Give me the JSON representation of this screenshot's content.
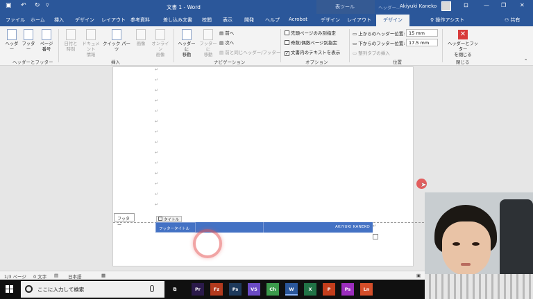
{
  "titlebar": {
    "document_title": "文書 1 - Word",
    "context_group": "表ツール",
    "context_dim": "ヘッダー...",
    "user_name": "Akiyuki Kaneko"
  },
  "tabs": {
    "items": [
      "ファイル",
      "ホーム",
      "挿入",
      "デザイン",
      "レイアウト",
      "参考資料",
      "差し込み文書",
      "校閲",
      "表示",
      "開発",
      "ヘルプ",
      "Acrobat",
      "デザイン",
      "レイアウト"
    ],
    "active": "デザイン",
    "assist": "操作アシスト",
    "share": "共有"
  },
  "ribbon": {
    "hf_group": {
      "label": "ヘッダーとフッター",
      "header": "ヘッダー",
      "footer": "フッター",
      "page_number": "ページ\n番号"
    },
    "insert_group": {
      "label": "挿入",
      "datetime": "日付と\n時刻",
      "docinfo": "ドキュメント\n情報",
      "quickparts": "クイック パーツ",
      "picture": "画像",
      "online_picture": "オンライン\n画像"
    },
    "nav_group": {
      "label": "ナビゲーション",
      "goto_header": "ヘッダーに\n移動",
      "goto_footer": "フッターに\n移動",
      "prev": "前へ",
      "next": "次へ",
      "link_prev": "前と同じヘッダー/フッター"
    },
    "options_group": {
      "label": "オプション",
      "first_page": "先頭ページのみ別指定",
      "odd_even": "奇数/偶数ページ別指定",
      "show_text": "文書内のテキストを表示"
    },
    "position_group": {
      "label": "位置",
      "header_top_label": "上からのヘッダー位置:",
      "header_top_value": "15 mm",
      "footer_bottom_label": "下からのフッター位置:",
      "footer_bottom_value": "17.5 mm",
      "align_tab": "整列タブの挿入"
    },
    "close_group": {
      "label": "閉じる",
      "close": "ヘッダーとフッター\nを閉じる"
    }
  },
  "document": {
    "paragraph_mark": "↵",
    "footer_label": "フッター",
    "title_tag": "タイトル",
    "footer_left": "フッタータイトル",
    "footer_right": "AKIYUKI KANEKO"
  },
  "statusbar": {
    "page": "1/3 ページ",
    "words": "0 文字",
    "language": "日本語"
  },
  "taskbar": {
    "search_placeholder": "ここに入力して検索",
    "apps": [
      "Pr",
      "Fz",
      "Ps",
      "VS",
      "Ch",
      "W",
      "X",
      "P",
      "Ps",
      "Ln"
    ],
    "app_colors": [
      "#2b1a4a",
      "#b23a1e",
      "#1e3a5c",
      "#6b4bc4",
      "#3c9a4c",
      "#2b579a",
      "#217346",
      "#c43e1c",
      "#9b2dbd",
      "#d44e2a"
    ]
  }
}
